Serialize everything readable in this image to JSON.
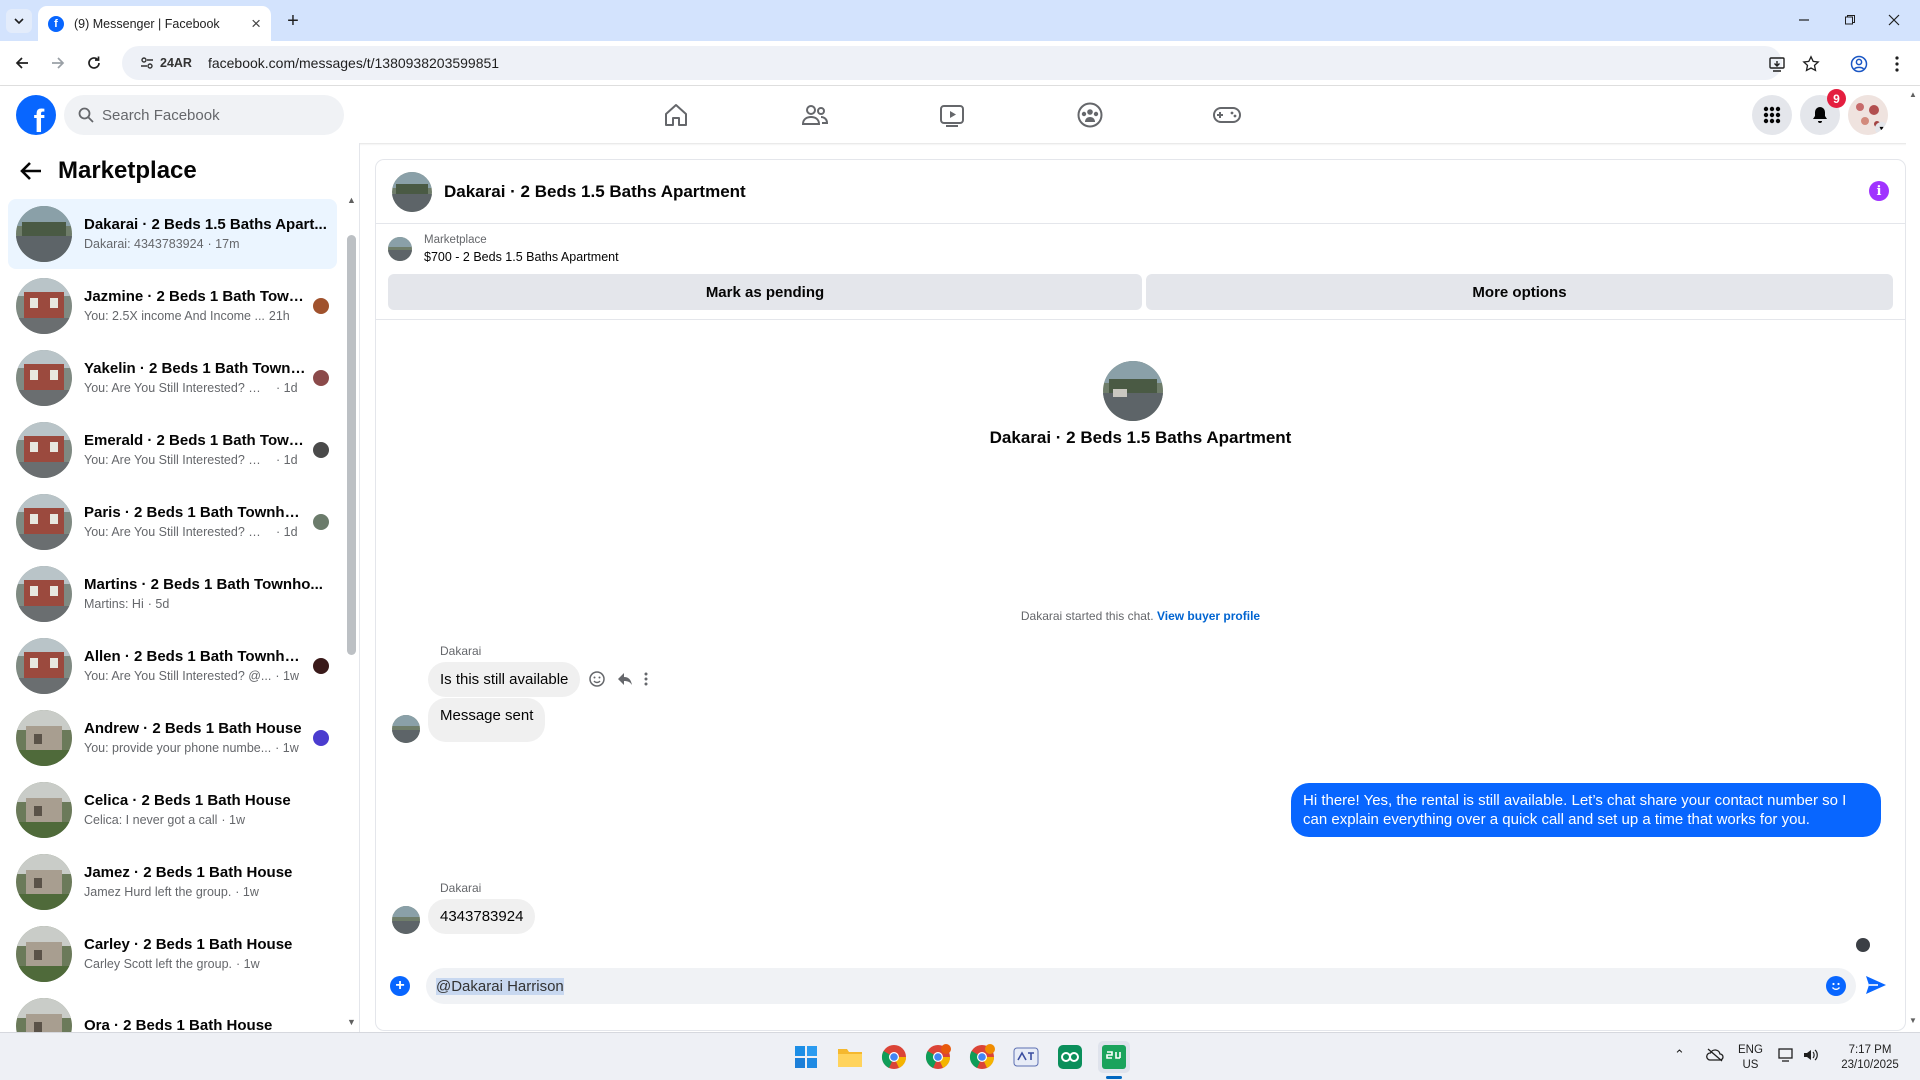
{
  "browser": {
    "tab_title": "(9) Messenger | Facebook",
    "address_chip": "24AR",
    "url": "facebook.com/messages/t/1380938203599851"
  },
  "fb": {
    "search_placeholder": "Search Facebook",
    "notification_count": "9"
  },
  "sidebar": {
    "title": "Marketplace",
    "chats": [
      {
        "name": "Dakarai · 2 Beds 1.5 Baths Apart...",
        "preview": "Dakarai: 4343783924",
        "time": "· 17m"
      },
      {
        "name": "Jazmine · 2 Beds 1 Bath Town...",
        "preview": "You: 2.5X income And Income ...",
        "time": "21h"
      },
      {
        "name": "Yakelin · 2 Beds 1 Bath Townh...",
        "preview": "You: Are You Still Interested? @Y...",
        "time": "· 1d"
      },
      {
        "name": "Emerald · 2 Beds 1 Bath Town...",
        "preview": "You: Are You Still Interested? @E...",
        "time": "· 1d"
      },
      {
        "name": "Paris · 2 Beds 1 Bath Townhouse",
        "preview": "You: Are You Still Interested? @P...",
        "time": "· 1d"
      },
      {
        "name": "Martins · 2 Beds 1 Bath Townho...",
        "preview": "Martins: Hi",
        "time": "· 5d"
      },
      {
        "name": "Allen · 2 Beds 1 Bath Townhou...",
        "preview": "You: Are You Still Interested? @...",
        "time": "· 1w"
      },
      {
        "name": "Andrew · 2 Beds 1 Bath House",
        "preview": "You: provide your phone numbe...",
        "time": "· 1w"
      },
      {
        "name": "Celica · 2 Beds 1 Bath House",
        "preview": "Celica: I never got a call",
        "time": "· 1w"
      },
      {
        "name": "Jamez · 2 Beds 1 Bath House",
        "preview": "Jamez Hurd left the group.",
        "time": "· 1w"
      },
      {
        "name": "Carley · 2 Beds 1 Bath House",
        "preview": "Carley Scott left the group.",
        "time": "· 1w"
      },
      {
        "name": "Ora · 2 Beds 1 Bath House",
        "preview": "",
        "time": ""
      }
    ]
  },
  "conversation": {
    "title": "Dakarai · 2 Beds 1.5 Baths Apartment",
    "listing_label": "Marketplace",
    "listing_title": "$700 - 2 Beds 1.5 Baths Apartment",
    "mark_pending": "Mark as pending",
    "more_options": "More options",
    "intro_name": "Dakarai · 2 Beds 1.5 Baths Apartment",
    "started_text": "Dakarai started this chat.",
    "view_profile": "View buyer profile",
    "sender": "Dakarai",
    "msg1": "Is this still available",
    "msg2": "Message sent",
    "msg_out": "Hi there! Yes, the rental is still available. Let’s chat share your contact number so I can explain everything over a quick call and set up a time that works for you.",
    "sender2": "Dakarai",
    "msg3": "4343783924",
    "composer_text": "@Dakarai Harrison"
  },
  "taskbar": {
    "lang1": "ENG",
    "lang2": "US",
    "time": "7:17 PM",
    "date": "23/10/2025"
  },
  "colors": {
    "accent": "#0866ff",
    "info": "#a033ff",
    "badge": "#e41e3f"
  }
}
